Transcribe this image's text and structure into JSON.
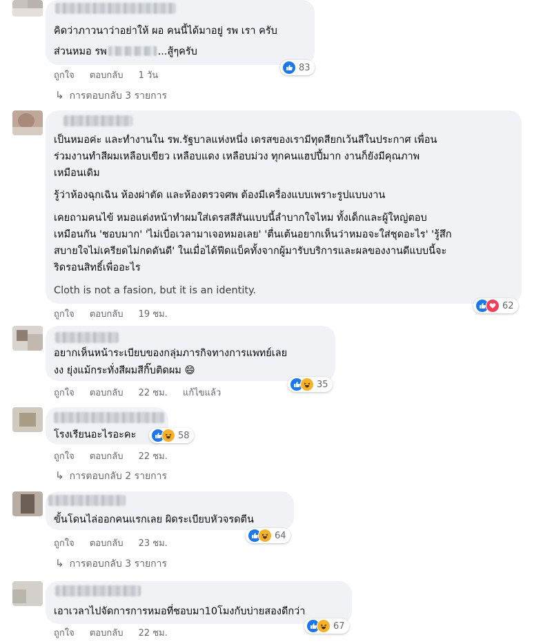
{
  "labels": {
    "like": "ถูกใจ",
    "reply": "ตอบกลับ",
    "edited": "แก้ไขแล้ว"
  },
  "comments": [
    {
      "lines": [
        "คิดว่าภาวนาว่าอย่าให้ ผอ คนนี้ได้มาอยู่ รพ เรา ครับ",
        "ส่วนหมอ รพ",
        "...สู้ๆครับ"
      ],
      "time": "1 วัน",
      "reactions": {
        "icons": [
          "like"
        ],
        "count": "83"
      },
      "replies": "การตอบกลับ 3 รายการ"
    },
    {
      "paragraphs": [
        [
          "เป็นหมอค่ะ และทำงานใน รพ.รัฐบาลแห่งหนึ่ง เดรสของเรามีทุดสียกเว้นสีในประกาศ เพื่อน",
          "ร่วมงานทำสีผมเหลือบเขียว เหลือบแดง เหลือบม่วง ทุกคนแฮปปี้มาก งานก็ยังมีคุณภาพ",
          "เหมือนเดิม"
        ],
        [
          "รู้ว่าห้องฉุกเฉิน ห้องผ่าตัด และห้องตรวจศพ ต้องมีเครื่องแบบเพราะรูปแบบงาน"
        ],
        [
          "เคยถามคนไข้ หมอแต่งหน้าทำผมใส่เดรสสีสันแบบนี้ลำบากใจไหม ทั้งเด็กและผู้ใหญ่ตอบ",
          "เหมือนกัน 'ชอบมาก' 'ไม่เบื่อเวลามาเจอหมอเลย' 'ตื่นเต้นอยากเห็นว่าหมอจะใส่ชุดอะไร' 'รู้สึก",
          "สบายใจไม่เครียดไม่กดดันดี' ในเมื่อได้ฟีดแบ็คทั้งจากผู้มารับบริการและผลของงานดีแบบนี้จะ",
          "ริดรอนสิทธิ์เพื่ออะไร"
        ],
        [
          "Cloth is not a fasion, but it is an identity."
        ]
      ],
      "time": "19 ชม.",
      "reactions": {
        "icons": [
          "like",
          "heart"
        ],
        "count": "62"
      }
    },
    {
      "lines": [
        "อยากเห็นหน้าระเบียบของกลุ่มภารกิจทางการแพทย์เลย",
        "งง ยุ่งแม้กระทั่งสีผมสีกิ๊บติดผม 😄"
      ],
      "time": "22 ชม.",
      "edited": true,
      "reactions": {
        "icons": [
          "like",
          "haha"
        ],
        "count": "35"
      }
    },
    {
      "lines": [
        "โรงเรียนอะไรอะคะ"
      ],
      "time": "22 ชม.",
      "reactions": {
        "icons": [
          "like",
          "haha"
        ],
        "count": "58"
      },
      "replies": "การตอบกลับ 2 รายการ"
    },
    {
      "lines": [
        "ขั้นโดนไล่ออกคนแรกเลย ผิดระเบียบหัวจรดตีน"
      ],
      "time": "23 ชม.",
      "reactions": {
        "icons": [
          "like",
          "haha"
        ],
        "count": "64"
      },
      "replies": "การตอบกลับ 3 รายการ"
    },
    {
      "lines": [
        "เอาเวลาไปจัดการการหมอที่ชอบมา10โมงกับบ่ายสองดีกว่า"
      ],
      "time": "22 ชม.",
      "reactions": {
        "icons": [
          "like",
          "haha"
        ],
        "count": "67"
      }
    }
  ]
}
